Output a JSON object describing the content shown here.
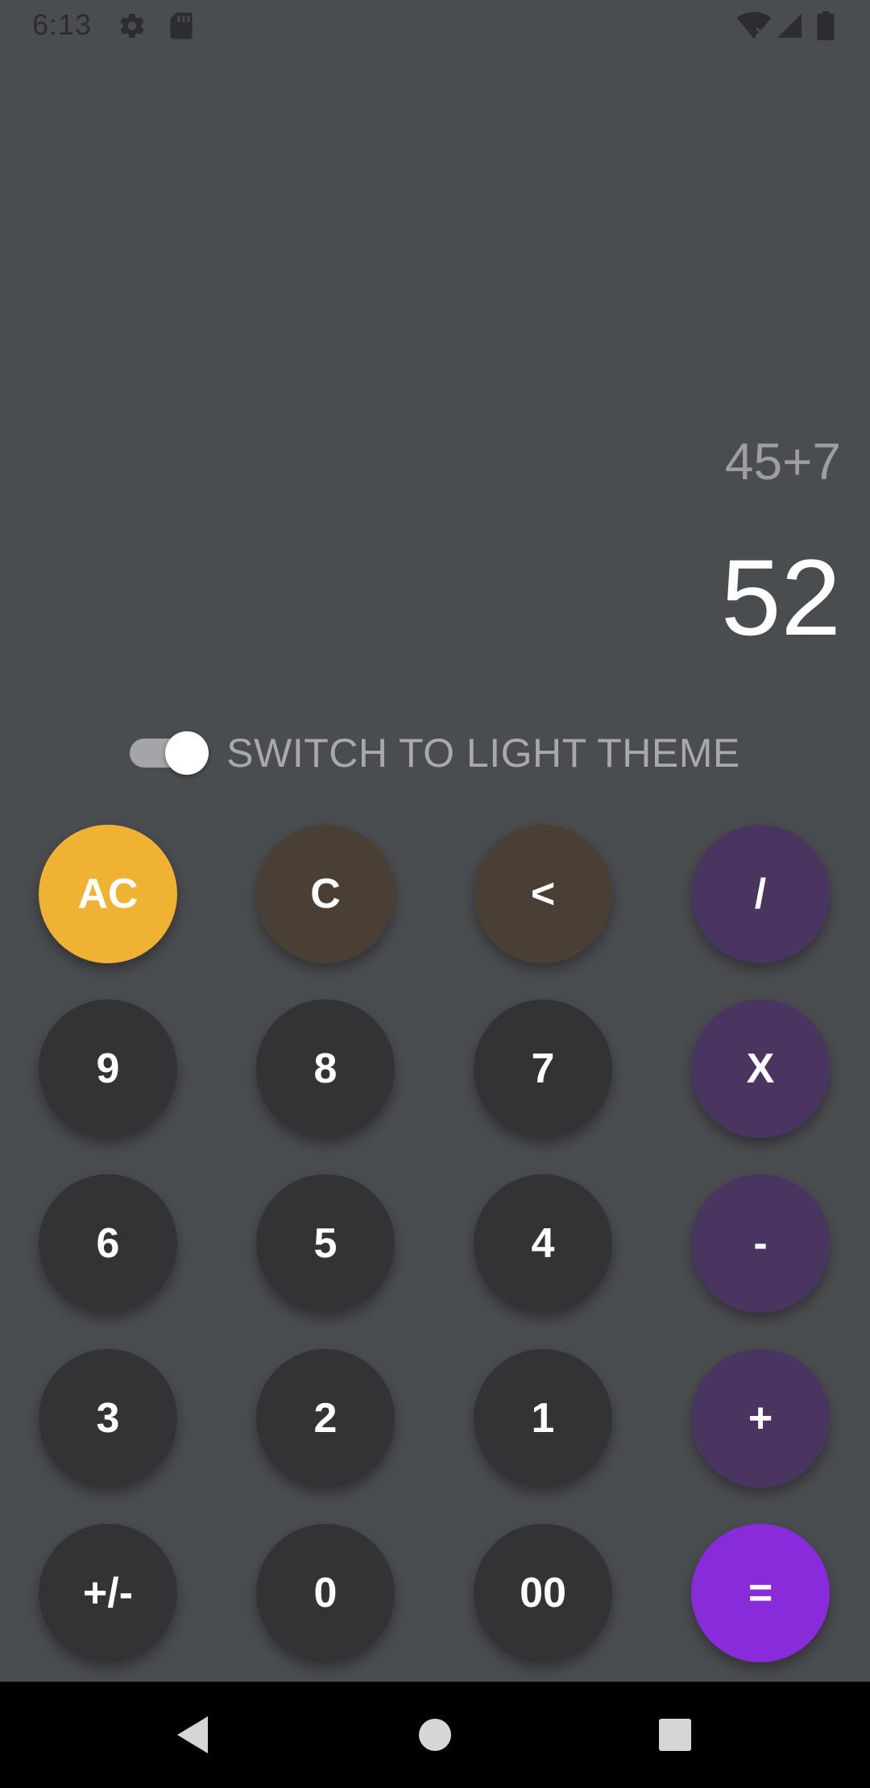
{
  "status_bar": {
    "time": "6:13",
    "icons": [
      "gear-icon",
      "sd-card-icon",
      "wifi-off-icon",
      "signal-icon",
      "battery-icon"
    ]
  },
  "display": {
    "expression": "45+7",
    "result": "52"
  },
  "theme_switch": {
    "label": "SWITCH TO LIGHT THEME",
    "on": true
  },
  "keypad": {
    "row1": [
      "AC",
      "C",
      "<",
      "/"
    ],
    "row2": [
      "9",
      "8",
      "7",
      "X"
    ],
    "row3": [
      "6",
      "5",
      "4",
      "-"
    ],
    "row4": [
      "3",
      "2",
      "1",
      "+"
    ],
    "row5": [
      "+/-",
      "0",
      "00",
      "="
    ]
  },
  "colors": {
    "background": "#4a4d50",
    "number_key": "#323335",
    "utility_key": "#4a3f35",
    "operator_key": "#4a3560",
    "clear_all_key": "#f0b232",
    "equals_key": "#8a2bdb"
  },
  "nav_bar": {
    "icons": [
      "back-icon",
      "home-icon",
      "recents-icon"
    ]
  }
}
